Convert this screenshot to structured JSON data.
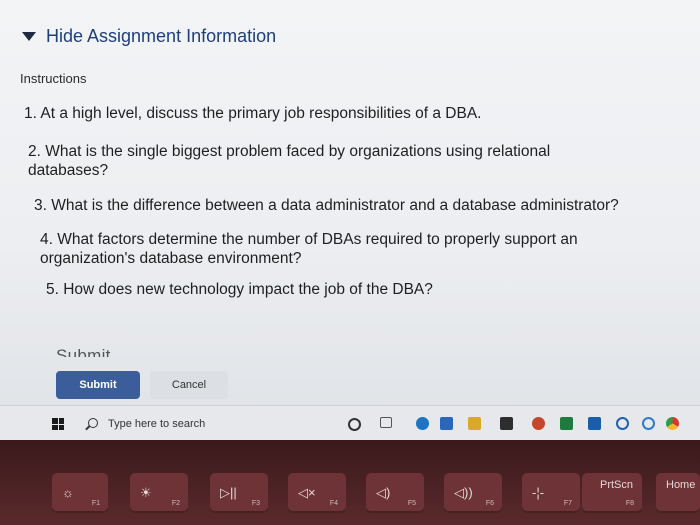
{
  "toggle": {
    "label": "Hide Assignment Information"
  },
  "instructions": {
    "label": "Instructions",
    "questions": [
      "1. At a high level, discuss the primary job responsibilities of a DBA.",
      "2. What is the single biggest problem faced by organizations using relational databases?",
      "3. What is the difference between a data administrator and a database administrator?",
      "4. What factors determine the number of DBAs required to properly support an organization's database environment?",
      "5. How does new technology impact the job of the DBA?"
    ]
  },
  "actions": {
    "heading": "Submit",
    "submit_label": "Submit",
    "cancel_label": "Cancel"
  },
  "taskbar": {
    "search_placeholder": "Type here to search",
    "icons": [
      "cortana-icon",
      "task-view-icon",
      "edge-icon",
      "store-icon",
      "files-icon",
      "office-icon",
      "powerpoint-icon",
      "excel-icon",
      "mail-icon",
      "app-icon",
      "app-icon",
      "chrome-icon"
    ]
  },
  "keyboard": {
    "keys": [
      {
        "glyph": "☼",
        "fn": "F1"
      },
      {
        "glyph": "☀",
        "fn": "F2"
      },
      {
        "glyph": "▷||",
        "fn": "F3"
      },
      {
        "glyph": "◁×",
        "fn": "F4"
      },
      {
        "glyph": "◁)",
        "fn": "F5"
      },
      {
        "glyph": "◁))",
        "fn": "F6"
      },
      {
        "glyph": "-¦-",
        "fn": "F7"
      },
      {
        "glyph": "PrtScn",
        "fn": "F8"
      },
      {
        "glyph": "Home",
        "fn": ""
      }
    ]
  },
  "colors": {
    "link": "#1e3f7a",
    "submit_bg": "#3b5e9a",
    "cancel_bg": "#dcdfe3",
    "keyboard": "#6e3336"
  }
}
